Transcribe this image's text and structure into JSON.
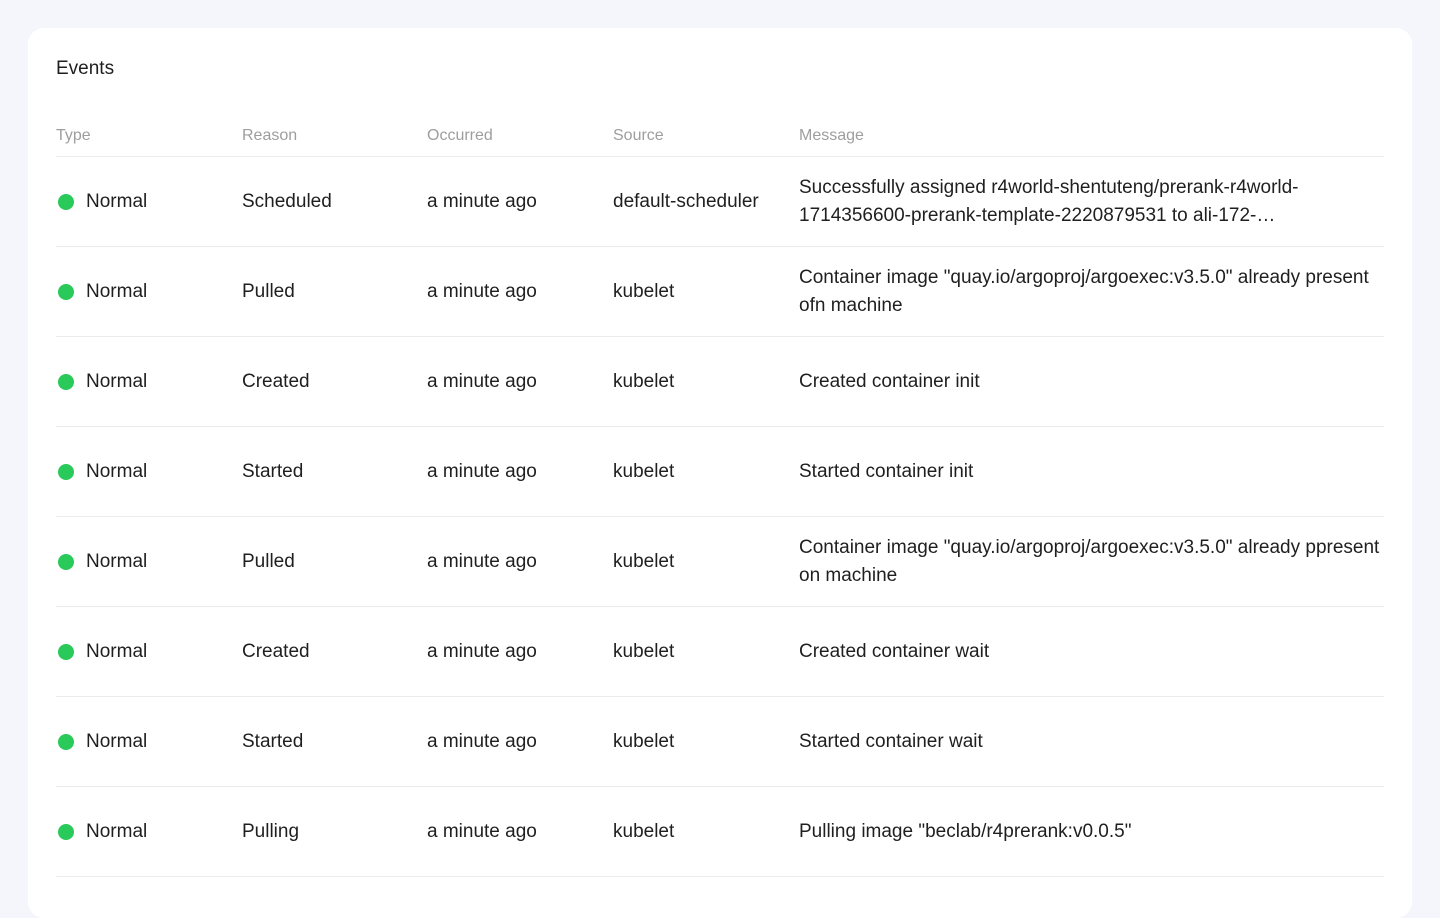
{
  "title": "Events",
  "columns": {
    "type": "Type",
    "reason": "Reason",
    "occurred": "Occurred",
    "source": "Source",
    "message": "Message"
  },
  "colors": {
    "status_dot": "#29c95a"
  },
  "rows": [
    {
      "type": "Normal",
      "reason": "Scheduled",
      "occurred": "a minute ago",
      "source": "default-scheduler",
      "message": "Successfully assigned r4world-shentuteng/prerank-r4world-1714356600-prerank-template-2220879531 to ali-172-…"
    },
    {
      "type": "Normal",
      "reason": "Pulled",
      "occurred": "a minute ago",
      "source": "kubelet",
      "message": "Container image \"quay.io/argoproj/argoexec:v3.5.0\" already present ofn machine"
    },
    {
      "type": "Normal",
      "reason": "Created",
      "occurred": "a minute ago",
      "source": "kubelet",
      "message": "Created container init"
    },
    {
      "type": "Normal",
      "reason": "Started",
      "occurred": "a minute ago",
      "source": "kubelet",
      "message": "Started container init"
    },
    {
      "type": "Normal",
      "reason": "Pulled",
      "occurred": "a minute ago",
      "source": "kubelet",
      "message": "Container image \"quay.io/argoproj/argoexec:v3.5.0\" already ppresent on machine"
    },
    {
      "type": "Normal",
      "reason": "Created",
      "occurred": "a minute ago",
      "source": "kubelet",
      "message": "Created container wait"
    },
    {
      "type": "Normal",
      "reason": "Started",
      "occurred": "a minute ago",
      "source": "kubelet",
      "message": "Started container wait"
    },
    {
      "type": "Normal",
      "reason": "Pulling",
      "occurred": "a minute ago",
      "source": "kubelet",
      "message": "Pulling image \"beclab/r4prerank:v0.0.5\""
    }
  ]
}
